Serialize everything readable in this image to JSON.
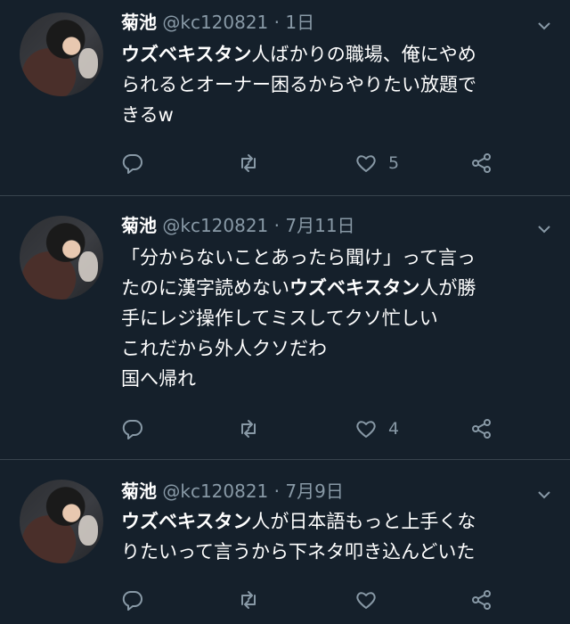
{
  "tweets": [
    {
      "name": "菊池",
      "handle": "@kc120821",
      "dot": "·",
      "time": "1日",
      "lines": [
        {
          "bold": "ウズベキスタン",
          "rest": "人ばかりの職場、俺にやめ"
        },
        {
          "text": "られるとオーナー困るからやりたい放題で"
        },
        {
          "text": "きるw"
        }
      ],
      "likes": "5"
    },
    {
      "name": "菊池",
      "handle": "@kc120821",
      "dot": "·",
      "time": "7月11日",
      "lines": [
        {
          "text": "「分からないことあったら聞け」って言っ"
        },
        {
          "pre": "たのに漢字読めない",
          "bold": "ウズベキスタン",
          "rest": "人が勝"
        },
        {
          "text": "手にレジ操作してミスしてクソ忙しい"
        },
        {
          "text": "これだから外人クソだわ"
        },
        {
          "text": "国へ帰れ"
        }
      ],
      "likes": "4"
    },
    {
      "name": "菊池",
      "handle": "@kc120821",
      "dot": "·",
      "time": "7月9日",
      "lines": [
        {
          "bold": "ウズベキスタン",
          "rest": "人が日本語もっと上手くな"
        },
        {
          "text": "りたいって言うから下ネタ叩き込んどいた"
        }
      ],
      "likes": ""
    }
  ],
  "icons": {
    "reply": "reply-icon",
    "retweet": "retweet-icon",
    "like": "heart-icon",
    "share": "share-icon",
    "menu": "chevron-down-icon"
  },
  "colors": {
    "background": "#15202b",
    "muted": "#8899a6",
    "divider": "#38444d"
  }
}
